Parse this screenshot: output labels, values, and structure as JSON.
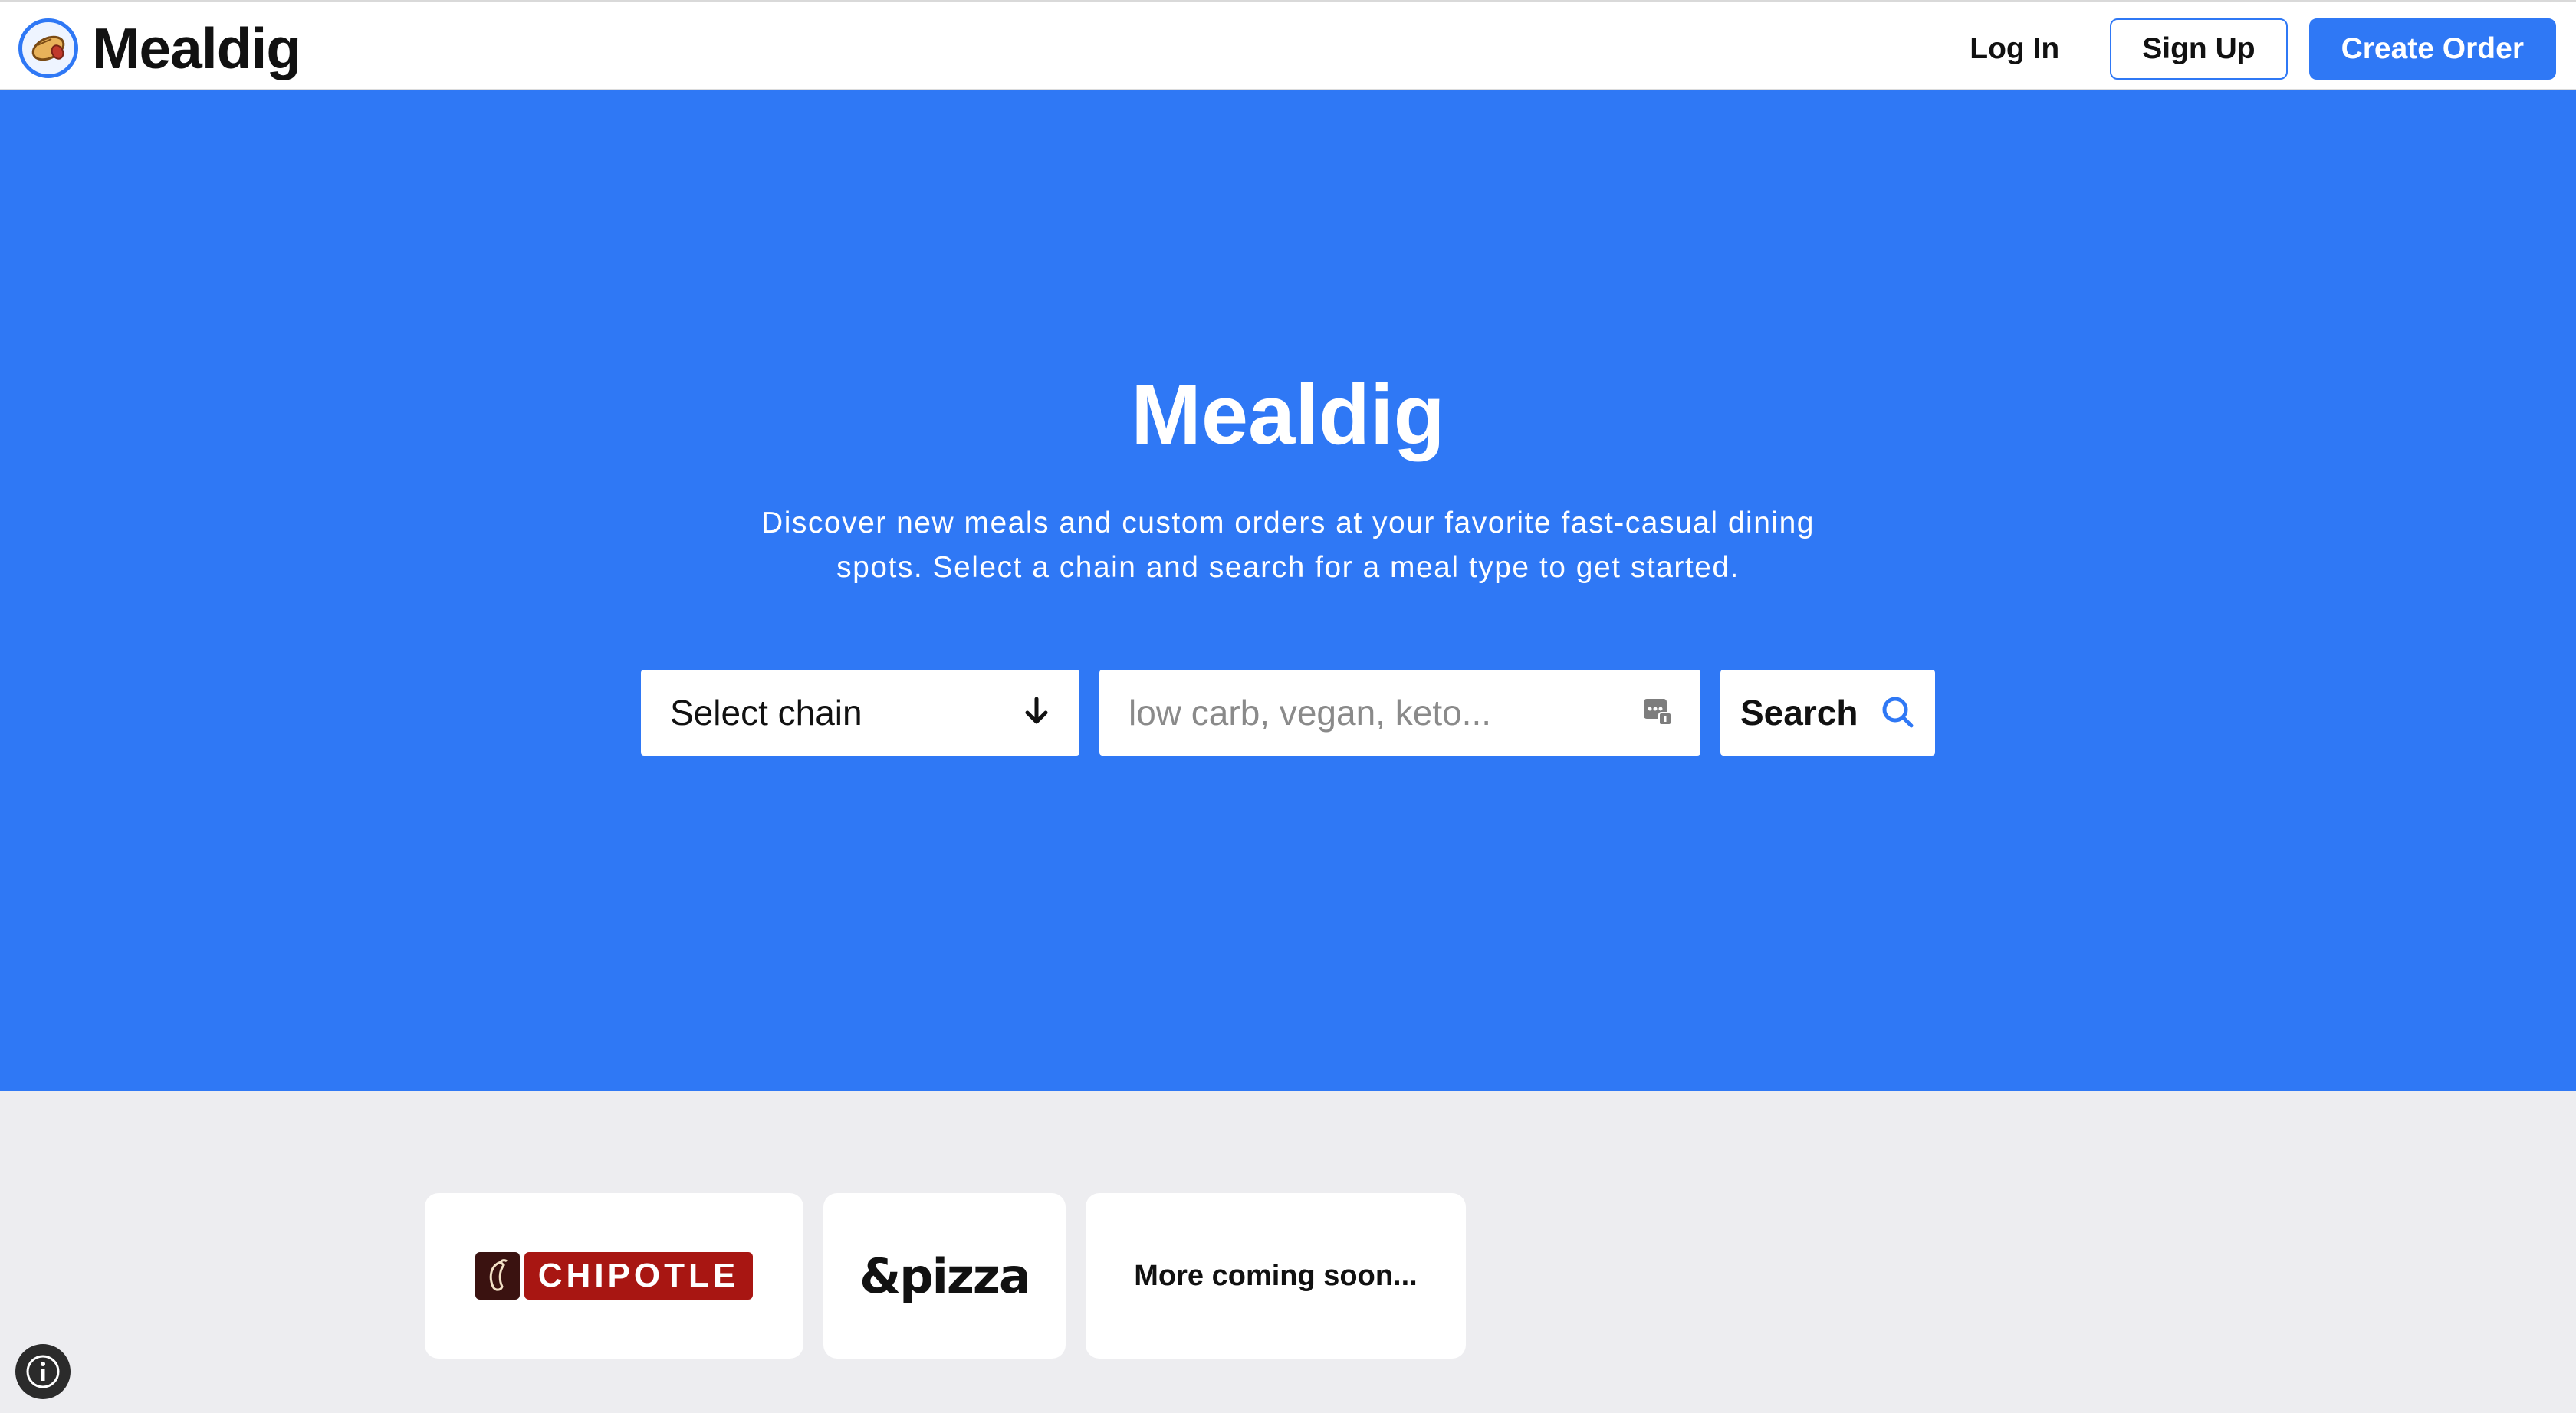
{
  "header": {
    "brand_name": "Mealdig",
    "logo_icon": "burrito-icon",
    "login_label": "Log In",
    "signup_label": "Sign Up",
    "create_order_label": "Create Order"
  },
  "hero": {
    "title": "Mealdig",
    "subtitle": "Discover new meals and custom orders at your favorite fast-casual dining spots. Select a chain and search for a meal type to get started.",
    "chain_select_label": "Select chain",
    "search_placeholder": "low carb, vegan, keto...",
    "search_button_label": "Search"
  },
  "chains": [
    {
      "name": "CHIPOTLE",
      "logo_icon": "chipotle-pepper-icon"
    },
    {
      "name": "&pizza"
    },
    {
      "name": "More coming soon..."
    }
  ],
  "colors": {
    "accent": "#2f78f5",
    "page_bg": "#ededf0",
    "chipotle_red": "#a81612"
  },
  "footer": {
    "info_icon": "info-icon"
  }
}
